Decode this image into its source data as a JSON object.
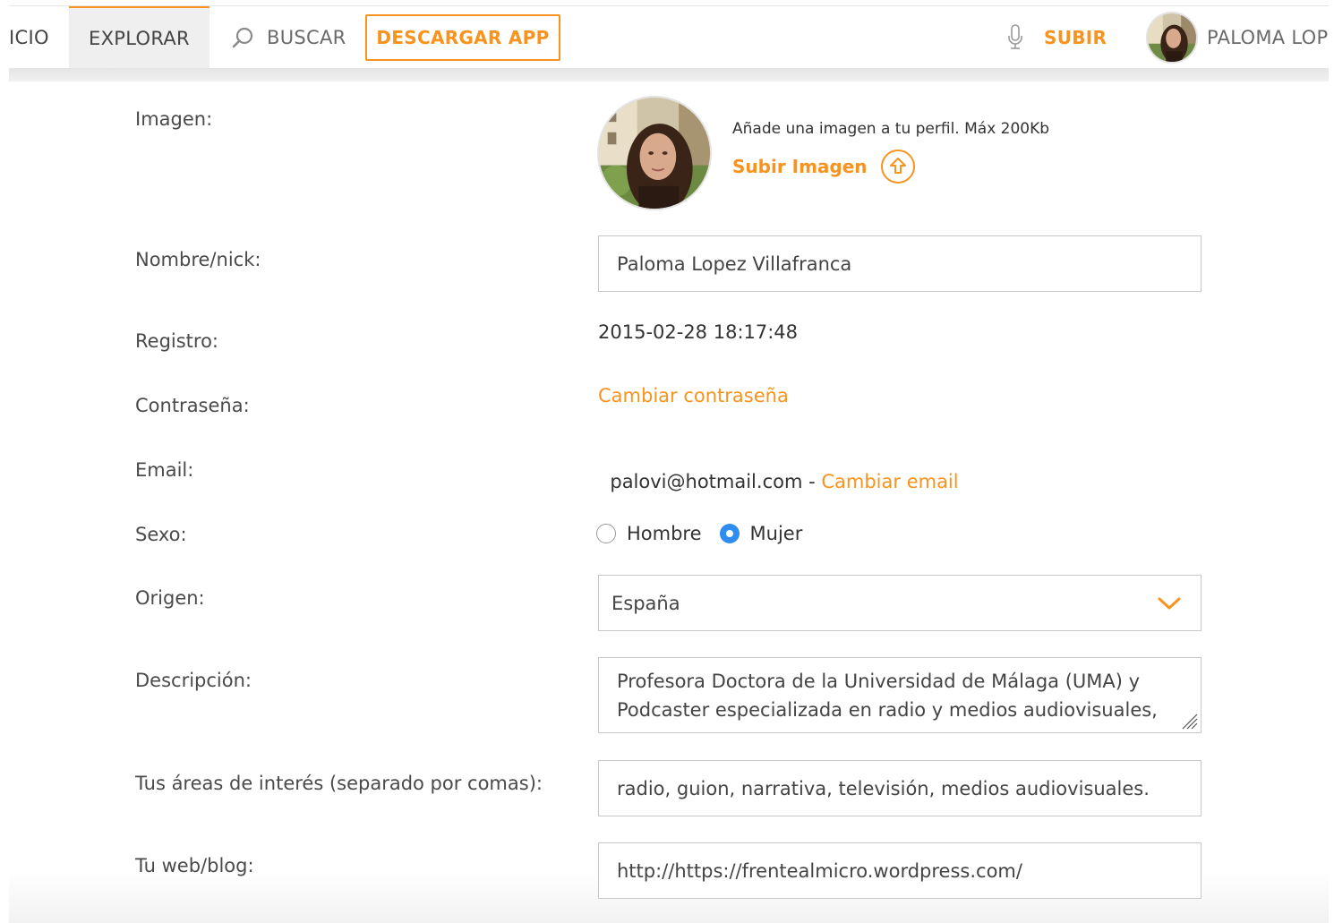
{
  "nav": {
    "inicio": "ICIO",
    "explorar": "EXPLORAR",
    "buscar": "BUSCAR",
    "descargar": "DESCARGAR APP",
    "subir": "SUBIR",
    "user_name": "PALOMA LOP"
  },
  "profile": {
    "image_label": "Imagen:",
    "image_hint": "Añade una imagen a tu perfil. Máx 200Kb",
    "upload_label": "Subir Imagen",
    "name_label": "Nombre/nick:",
    "name_value": "Paloma Lopez Villafranca",
    "registro_label": "Registro:",
    "registro_value": "2015-02-28 18:17:48",
    "password_label": "Contraseña:",
    "password_link": "Cambiar contraseña",
    "email_label": "Email:",
    "email_value": "palovi@hotmail.com",
    "email_separator": " - ",
    "email_link": "Cambiar email",
    "sexo_label": "Sexo:",
    "sexo_options": [
      "Hombre",
      "Mujer"
    ],
    "sexo_selected": "Mujer",
    "origen_label": "Origen:",
    "origen_value": "España",
    "descripcion_label": "Descripción:",
    "descripcion_value": "Profesora Doctora de la Universidad de Málaga (UMA) y Podcaster especializada en radio y medios audiovisuales,",
    "intereses_label": "Tus áreas de interés (separado por comas):",
    "intereses_value": "radio, guion, narrativa, televisión, medios audiovisuales.",
    "web_label": "Tu web/blog:",
    "web_value": "http://https://frentealmicro.wordpress.com/"
  },
  "colors": {
    "accent": "#f7931e",
    "radio_selected": "#2f8cf0"
  },
  "icons": [
    "search-icon",
    "microphone-icon",
    "upload-arrow-icon",
    "chevron-down-icon",
    "resize-handle-icon"
  ]
}
